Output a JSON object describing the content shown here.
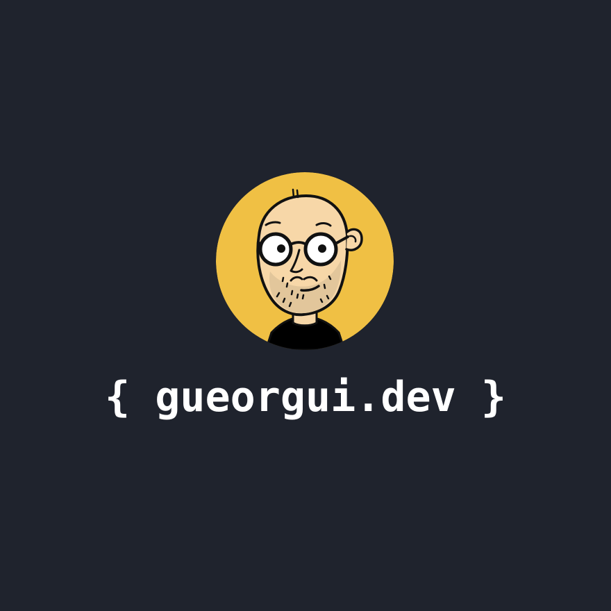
{
  "wordmark": {
    "text": "{ gueorgui.dev }"
  },
  "avatar": {
    "icon": "cartoon-portrait-icon"
  },
  "colors": {
    "background": "#1f232d",
    "avatar_circle": "#f0c044",
    "skin": "#f7d7a8",
    "beard": "#e2c69b",
    "ink": "#111111",
    "text": "#ffffff"
  }
}
